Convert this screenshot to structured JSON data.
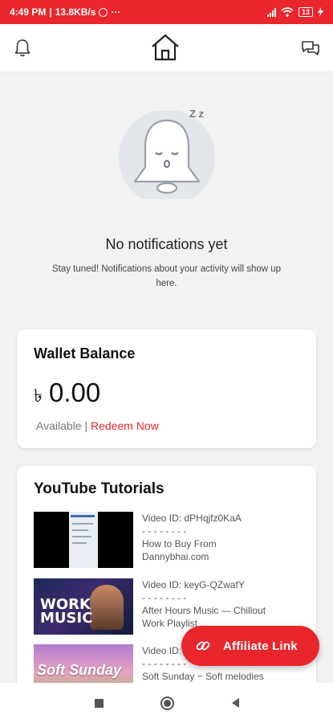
{
  "status": {
    "time": "4:49 PM",
    "speed": "13.8KB/s",
    "dots": "···",
    "battery": "13"
  },
  "topbar": {
    "bell_icon": "bell-icon",
    "home_icon": "home-icon",
    "chat_icon": "chat-icon"
  },
  "empty_state": {
    "zz": "Z z",
    "title": "No notifications yet",
    "subtitle": "Stay tuned! Notifications about your activity will show up here."
  },
  "wallet": {
    "title": "Wallet Balance",
    "currency": "৳",
    "amount": "0.00",
    "available": "Available",
    "separator": "|",
    "redeem": "Redeem Now"
  },
  "tutorials": {
    "title": "YouTube Tutorials",
    "videos": [
      {
        "id": "Video ID: dPHqjfz0KaA",
        "dashes": "- - - - - - - -",
        "title": "How to Buy From",
        "title2": "Dannybhai.com"
      },
      {
        "id": "Video ID: keyG-QZwafY",
        "dashes": "- - - - - - - -",
        "title": "After Hours Music — Chillout",
        "title2": "Work Playlist",
        "thumb_text1": "WORK",
        "thumb_text2": "MUSIC"
      },
      {
        "id": "Video ID:",
        "dashes": "- - - - - - - -",
        "title": "Soft Sunday ~ Soft melodies",
        "title2": "",
        "thumb_text": "Soft Sunday"
      }
    ]
  },
  "fab": {
    "label": "Affiliate Link",
    "icon": "link-icon"
  },
  "colors": {
    "accent": "#e8262b"
  }
}
